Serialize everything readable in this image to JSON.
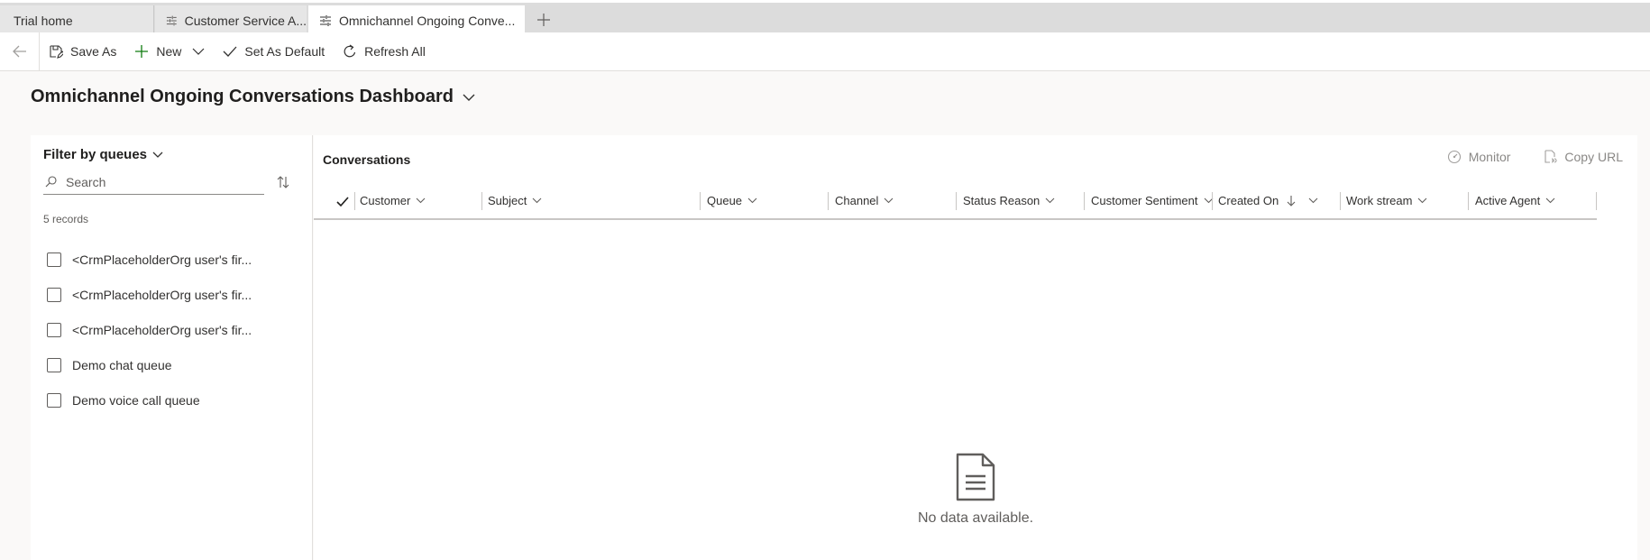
{
  "tabs": [
    {
      "label": "Trial home",
      "active": false
    },
    {
      "label": "Customer Service A...",
      "active": false
    },
    {
      "label": "Omnichannel Ongoing Conve...",
      "active": true
    }
  ],
  "toolbar": {
    "save_as": "Save As",
    "new": "New",
    "set_as_default": "Set As Default",
    "refresh_all": "Refresh All"
  },
  "page": {
    "title": "Omnichannel Ongoing Conversations Dashboard"
  },
  "filter": {
    "title": "Filter by queues",
    "search_placeholder": "Search",
    "record_count": "5 records",
    "queues": [
      {
        "label": "<CrmPlaceholderOrg user's fir...",
        "checked": false
      },
      {
        "label": "<CrmPlaceholderOrg user's fir...",
        "checked": false
      },
      {
        "label": "<CrmPlaceholderOrg user's fir...",
        "checked": false
      },
      {
        "label": "Demo chat queue",
        "checked": false
      },
      {
        "label": "Demo voice call queue",
        "checked": false
      }
    ]
  },
  "grid": {
    "title": "Conversations",
    "monitor": "Monitor",
    "copy_url": "Copy URL",
    "columns": [
      {
        "label": "Customer"
      },
      {
        "label": "Subject"
      },
      {
        "label": "Queue"
      },
      {
        "label": "Channel"
      },
      {
        "label": "Status Reason"
      },
      {
        "label": "Customer Sentiment"
      },
      {
        "label": "Created On",
        "sort": "descending"
      },
      {
        "label": "Work stream"
      },
      {
        "label": "Active Agent"
      }
    ],
    "empty_message": "No data available."
  },
  "colors": {
    "accent": "#0078d4",
    "positive": "#107c10",
    "text": "#323130",
    "muted": "#605e5c",
    "disabled": "#8a8886"
  }
}
